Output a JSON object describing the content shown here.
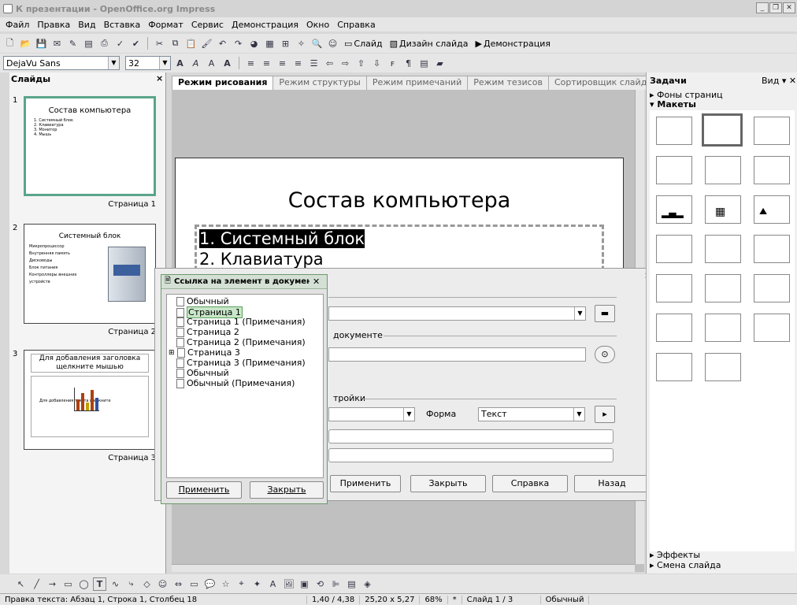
{
  "window": {
    "title": "К презентации - OpenOffice.org Impress"
  },
  "menu": [
    "Файл",
    "Правка",
    "Вид",
    "Вставка",
    "Формат",
    "Сервис",
    "Демонстрация",
    "Окно",
    "Справка"
  ],
  "toolbar": {
    "slide": "Слайд",
    "design": "Дизайн слайда",
    "show": "Демонстрация"
  },
  "format": {
    "font": "DejaVu Sans",
    "size": "32"
  },
  "slides_panel": {
    "title": "Слайды",
    "items": [
      {
        "num": "1",
        "title": "Состав компьютера",
        "bullets": [
          "1. Системный блок",
          "2. Клавиатура",
          "3. Монитор",
          "4. Мышь"
        ],
        "page": "Страница 1"
      },
      {
        "num": "2",
        "title": "Системный блок",
        "bullets": [
          "Микропроцессор",
          "Внутренняя память",
          "Дисководы",
          "Блок питания",
          "Контроллеры внешних устройств"
        ],
        "page": "Страница 2"
      },
      {
        "num": "3",
        "title": "Для добавления заголовка щелкните мышью",
        "body": "Для добавления текста щелкните",
        "page": "Страница 3"
      }
    ]
  },
  "view_tabs": [
    "Режим рисования",
    "Режим структуры",
    "Режим примечаний",
    "Режим тезисов",
    "Сортировщик слайдов"
  ],
  "slide": {
    "title": "Состав компьютера",
    "items": [
      "1. Системный блок",
      "2. Клавиатура"
    ]
  },
  "hyperlink_dialog": {
    "doc_section": "документе",
    "settings_section": "тройки",
    "form_label": "Форма",
    "form_value": "Текст",
    "apply": "Применить",
    "close": "Закрыть",
    "help": "Справка",
    "back": "Назад"
  },
  "navigator": {
    "title": "Ссылка на элемент в докумен",
    "items": [
      "Обычный",
      "Страница 1",
      "Страница 1 (Примечания)",
      "Страница 2",
      "Страница 2 (Примечания)",
      "Страница 3",
      "Страница 3 (Примечания)",
      "Обычный",
      "Обычный (Примечания)"
    ],
    "apply": "Применить",
    "close": "Закрыть"
  },
  "tasks": {
    "title": "Задачи",
    "view": "Вид",
    "sections": {
      "masters": "Фоны страниц",
      "layouts": "Макеты",
      "effects": "Эффекты",
      "transition": "Смена слайда"
    }
  },
  "status": {
    "edit": "Правка текста: Абзац 1, Строка 1, Столбец 18",
    "pos": "1,40 / 4,38",
    "size": "25,20 x 5,27",
    "zoom": "68%",
    "mod": "*",
    "slide": "Слайд 1 / 3",
    "layout": "Обычный"
  }
}
